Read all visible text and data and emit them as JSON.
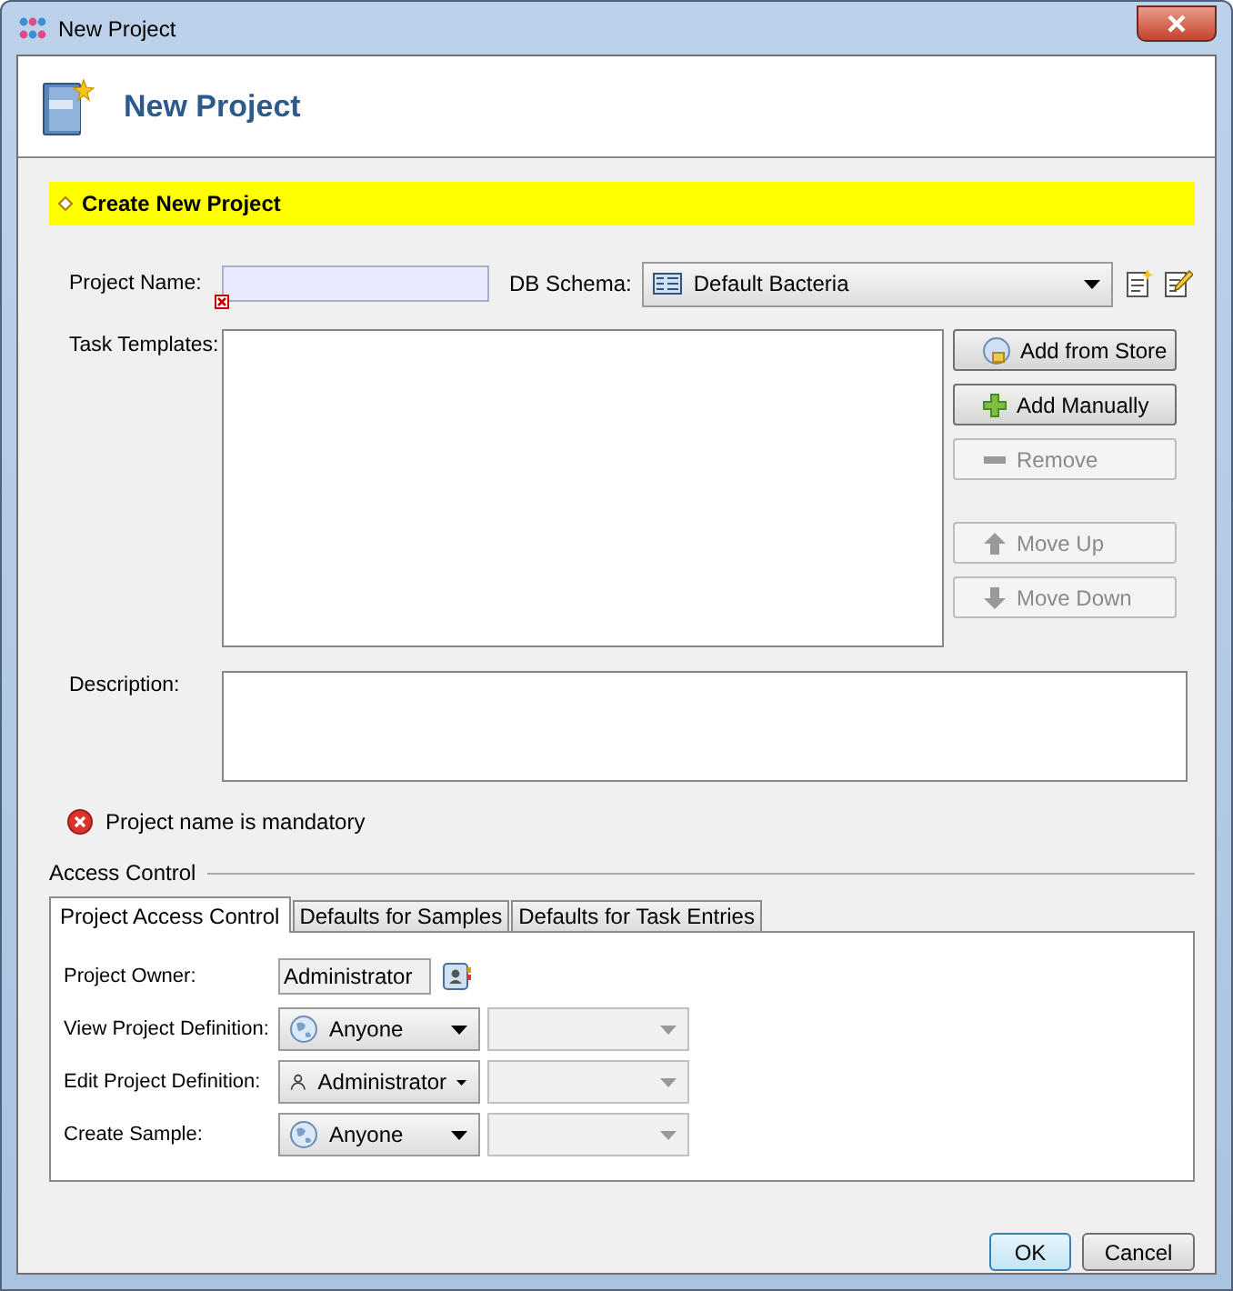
{
  "window": {
    "title": "New Project"
  },
  "header": {
    "title": "New Project"
  },
  "section": {
    "title": "Create New Project"
  },
  "project_name": {
    "label": "Project Name:",
    "invalid": true
  },
  "db_schema": {
    "label": "DB Schema:",
    "value": "Default Bacteria"
  },
  "task_templates": {
    "label": "Task Templates:"
  },
  "template_buttons": [
    {
      "label": "Add from Store",
      "disabled": false
    },
    {
      "label": "Add Manually",
      "disabled": false
    },
    {
      "label": "Remove",
      "disabled": true
    },
    {
      "label": "Move Up",
      "disabled": true
    },
    {
      "label": "Move Down",
      "disabled": true
    }
  ],
  "description": {
    "label": "Description:"
  },
  "error": {
    "text": "Project name is mandatory"
  },
  "access_control": {
    "title": "Access Control",
    "tabs": [
      {
        "label": "Project Access Control",
        "selected": true
      },
      {
        "label": "Defaults for Samples",
        "selected": false
      },
      {
        "label": "Defaults for Task Entries",
        "selected": false
      }
    ],
    "rows": [
      {
        "kind": "field",
        "label": "Project Owner:",
        "value": "Administrator"
      },
      {
        "kind": "group",
        "label": "View Project Definition:",
        "value": "Anyone"
      },
      {
        "kind": "user",
        "label": "Edit Project Definition:",
        "value": "Administrator"
      },
      {
        "kind": "group",
        "label": "Create Sample:",
        "value": "Anyone"
      }
    ]
  },
  "buttons": [
    {
      "label": "OK",
      "default": true
    },
    {
      "label": "Cancel",
      "default": false
    }
  ]
}
